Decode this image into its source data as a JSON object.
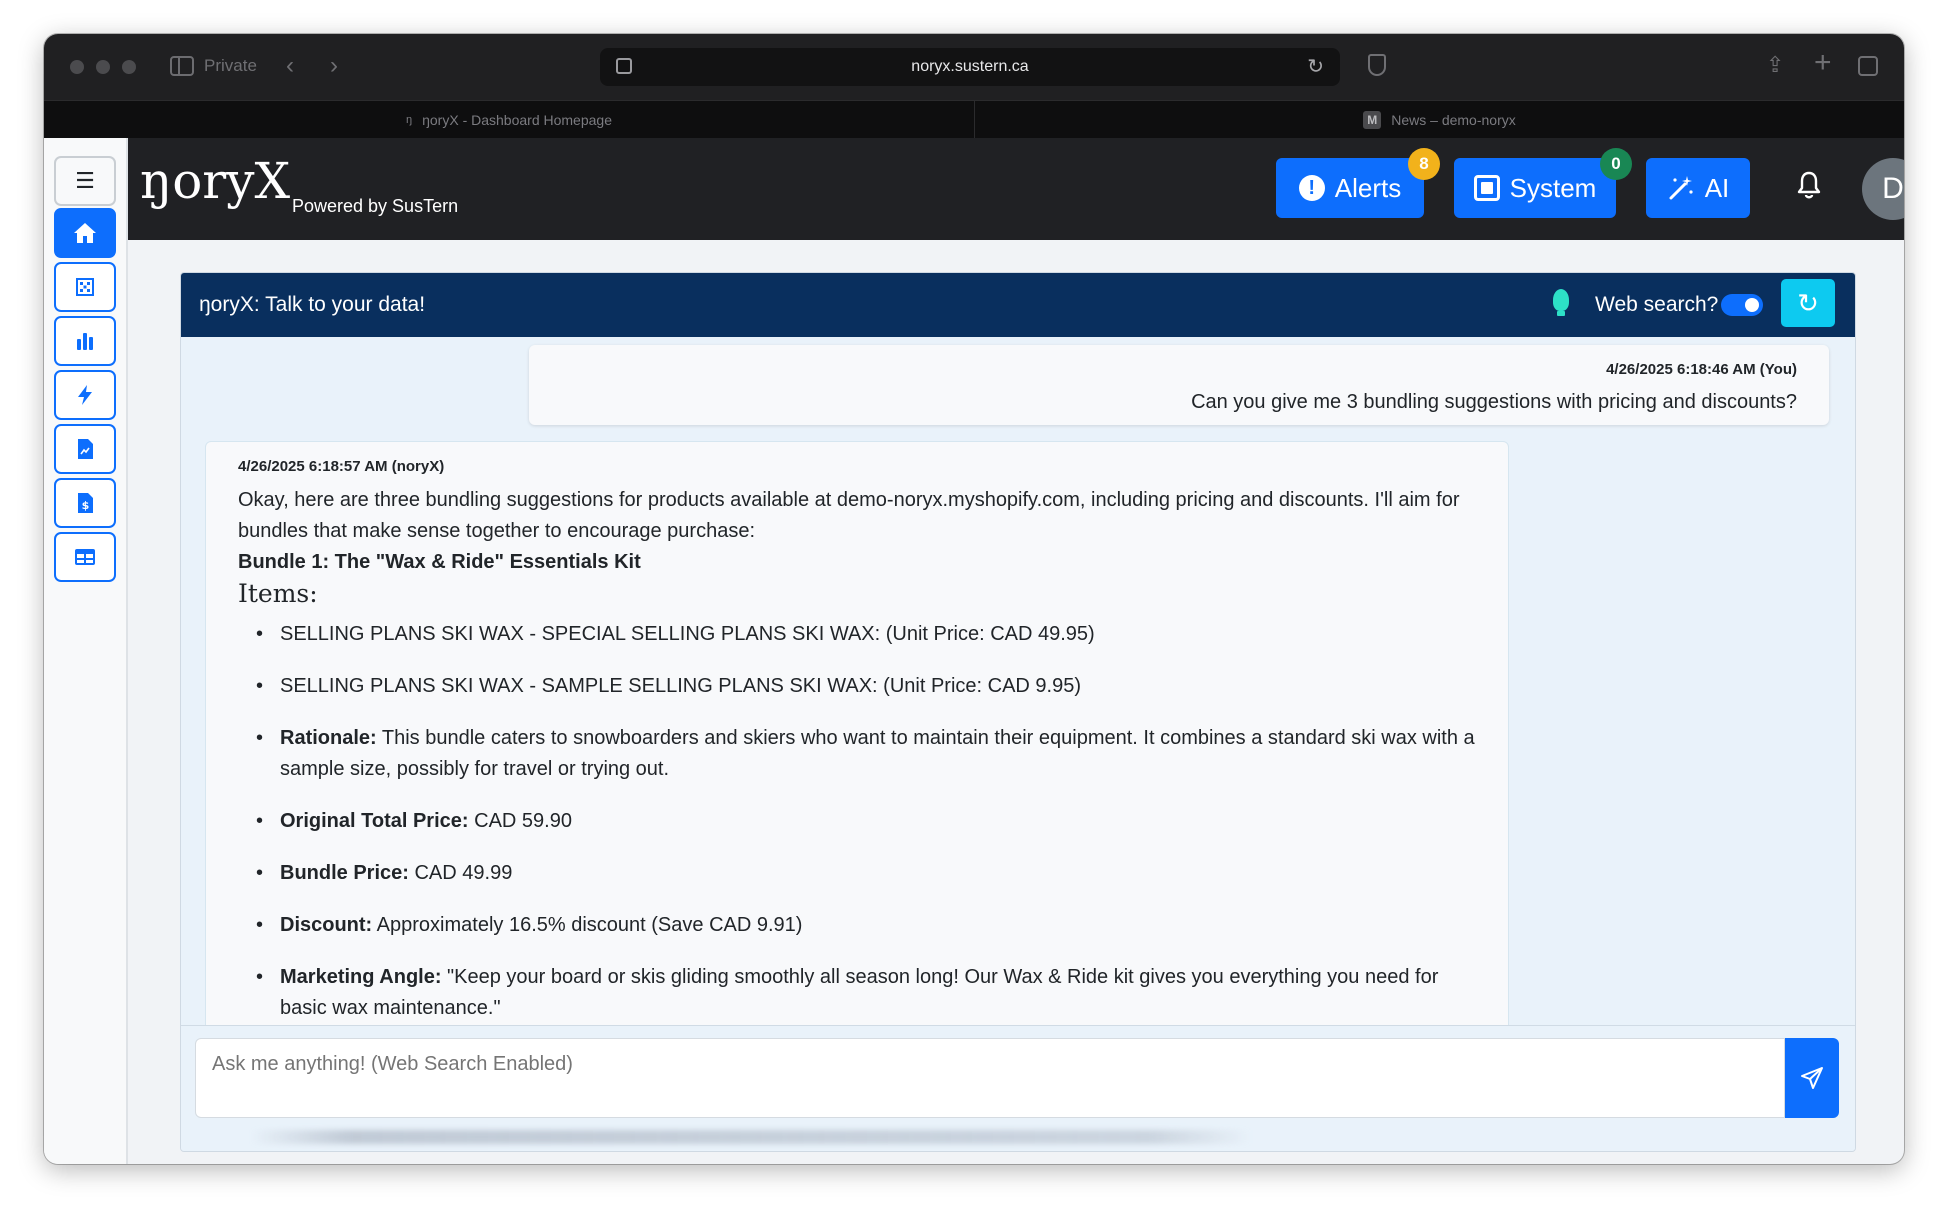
{
  "browser": {
    "private_label": "Private",
    "url": "noryx.sustern.ca",
    "tabs": [
      {
        "label": "ŋoryX - Dashboard Homepage"
      },
      {
        "label": "News – demo-noryx",
        "favicon_letter": "M"
      }
    ]
  },
  "navbar": {
    "brand": "ŋoryX",
    "powered_by": "Powered by SusTern",
    "alerts": {
      "label": "Alerts",
      "badge": "8",
      "badge_color": "#f2b21b"
    },
    "system": {
      "label": "System",
      "badge": "0",
      "badge_color": "#198754"
    },
    "ai": {
      "label": "AI"
    },
    "avatar_letter": "D",
    "accent_color": "#0d6efd"
  },
  "sidebar": {
    "items": [
      {
        "name": "menu",
        "icon": "hamburger-icon"
      },
      {
        "name": "home",
        "icon": "home-icon",
        "active": true
      },
      {
        "name": "grid",
        "icon": "grid-icon"
      },
      {
        "name": "charts",
        "icon": "bar-chart-icon"
      },
      {
        "name": "automation",
        "icon": "lightning-icon"
      },
      {
        "name": "reports",
        "icon": "file-chart-icon"
      },
      {
        "name": "billing",
        "icon": "file-dollar-icon"
      },
      {
        "name": "tables",
        "icon": "table-icon"
      }
    ]
  },
  "chat": {
    "title": "ŋoryX: Talk to your data!",
    "web_search_label": "Web search?",
    "web_search_enabled": true,
    "user_message": {
      "timestamp": "4/26/2025 6:18:46 AM (You)",
      "text": "Can you give me 3 bundling suggestions with pricing and discounts?"
    },
    "bot_message": {
      "timestamp": "4/26/2025 6:18:57 AM (noryX)",
      "intro": "Okay, here are three bundling suggestions for products available at demo-noryx.myshopify.com, including pricing and discounts. I'll aim for bundles that make sense together to encourage purchase:",
      "bundle_title": "Bundle 1: The \"Wax & Ride\" Essentials Kit",
      "items_heading": "Items:",
      "bullets": [
        {
          "label": "",
          "text": "SELLING PLANS SKI WAX - SPECIAL SELLING PLANS SKI WAX: (Unit Price: CAD 49.95)"
        },
        {
          "label": "",
          "text": "SELLING PLANS SKI WAX - SAMPLE SELLING PLANS SKI WAX: (Unit Price: CAD 9.95)"
        },
        {
          "label": "Rationale:",
          "text": " This bundle caters to snowboarders and skiers who want to maintain their equipment. It combines a standard ski wax with a sample size, possibly for travel or trying out."
        },
        {
          "label": "Original Total Price:",
          "text": " CAD 59.90"
        },
        {
          "label": "Bundle Price:",
          "text": " CAD 49.99"
        },
        {
          "label": "Discount:",
          "text": " Approximately 16.5% discount (Save CAD 9.91)"
        },
        {
          "label": "Marketing Angle:",
          "text": " \"Keep your board or skis gliding smoothly all season long! Our Wax & Ride kit gives you everything you need for basic wax maintenance.\""
        }
      ]
    },
    "input_placeholder": "Ask me anything! (Web Search Enabled)"
  }
}
